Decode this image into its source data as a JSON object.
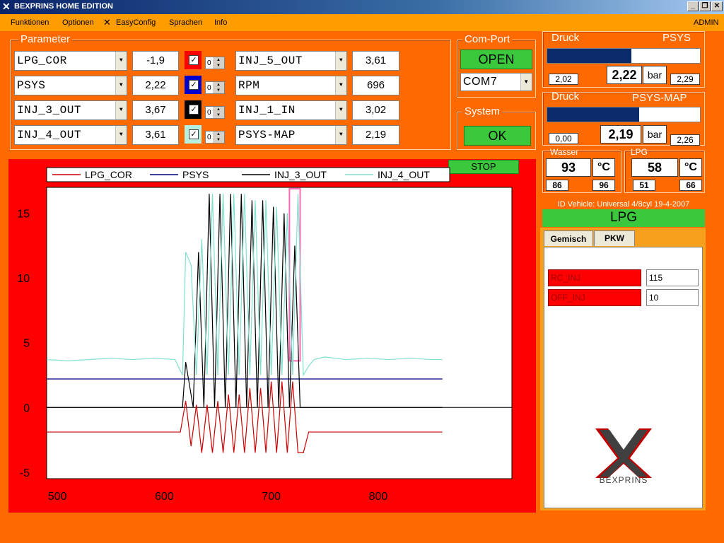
{
  "window": {
    "title": "BEXPRINS  HOME EDITION"
  },
  "menu": {
    "items": [
      "Funktionen",
      "Optionen",
      "EasyConfig",
      "Sprachen",
      "Info"
    ],
    "user": "ADMIN"
  },
  "parameter": {
    "label": "Parameter",
    "left_rows": [
      {
        "name": "LPG_COR",
        "value": "-1,9",
        "color": "#ff0000",
        "checked": true,
        "spin": "0"
      },
      {
        "name": "PSYS",
        "value": "2,22",
        "color": "#0000cc",
        "checked": true,
        "spin": "0"
      },
      {
        "name": "INJ_3_OUT",
        "value": "3,67",
        "color": "#000000",
        "checked": true,
        "spin": "0"
      },
      {
        "name": "INJ_4_OUT",
        "value": "3,61",
        "color": "#b7f0e0",
        "checked": true,
        "spin": "0"
      }
    ],
    "right_rows": [
      {
        "name": "INJ_5_OUT",
        "value": "3,61"
      },
      {
        "name": "RPM",
        "value": "696"
      },
      {
        "name": "INJ_1_IN",
        "value": "3,02"
      },
      {
        "name": "PSYS-MAP",
        "value": "2,19"
      }
    ]
  },
  "comport": {
    "label": "Com-Port",
    "open_label": "OPEN",
    "port": "COM7"
  },
  "system": {
    "label": "System",
    "status": "OK"
  },
  "druck1": {
    "label": "Druck",
    "name": "PSYS",
    "min": "2,02",
    "value": "2,22",
    "unit": "bar",
    "max": "2,29",
    "fill": 0.55
  },
  "druck2": {
    "label": "Druck",
    "name": "PSYS-MAP",
    "min": "0,00",
    "value": "2,19",
    "unit": "bar",
    "max": "2,26",
    "fill": 0.6
  },
  "wasser": {
    "label": "Wasser",
    "value": "93",
    "unit": "°C",
    "min": "86",
    "max": "96"
  },
  "lpg_temp": {
    "label": "LPG",
    "value": "58",
    "unit": "°C",
    "min": "51",
    "max": "66"
  },
  "vehicle": {
    "id_text": "ID Vehicle: Universal 4/8cyl 19-4-2007",
    "fuel": "LPG"
  },
  "tabs": {
    "items": [
      "Gemisch",
      "PKW"
    ]
  },
  "gemisch": [
    {
      "label": "RC_INJ",
      "value": "115"
    },
    {
      "label": "OFF_INJ",
      "value": "10"
    }
  ],
  "logo_text": "BEXPRINS",
  "stop_label": "STOP",
  "chart_data": {
    "type": "line",
    "legend": [
      "LPG_COR",
      "PSYS",
      "INJ_3_OUT",
      "INJ_4_OUT"
    ],
    "xlim": [
      490,
      925
    ],
    "ylim": [
      -5.5,
      17
    ],
    "xticks": [
      "500",
      "600",
      "700",
      "800"
    ],
    "yticks": [
      "15",
      "10",
      "5",
      "0",
      "-5"
    ],
    "colors": {
      "LPG_COR": "#cc0000",
      "PSYS": "#000080",
      "INJ_3_OUT": "#000000",
      "INJ_4_OUT": "#7fe0d0"
    },
    "series": [
      {
        "name": "PSYS",
        "x": [
          490,
          860
        ],
        "y": [
          2.2,
          2.2
        ]
      },
      {
        "name": "INJ_3_OUT",
        "x": [
          490,
          617,
          620,
          627,
          632,
          637,
          642,
          647,
          652,
          657,
          662,
          667,
          672,
          677,
          682,
          687,
          692,
          697,
          702,
          707,
          712,
          717,
          722,
          727,
          730,
          860
        ],
        "y": [
          0,
          0,
          3.5,
          0,
          12,
          0,
          16.5,
          0,
          16.5,
          0,
          16.5,
          0,
          16.5,
          0,
          16,
          0,
          16,
          0,
          15.5,
          0,
          15,
          0,
          12.5,
          0,
          0,
          0
        ]
      },
      {
        "name": "INJ_4_OUT",
        "x": [
          490,
          510,
          530,
          550,
          570,
          590,
          610,
          617,
          620,
          625,
          630,
          635,
          640,
          645,
          650,
          655,
          660,
          665,
          670,
          675,
          680,
          685,
          690,
          695,
          700,
          705,
          710,
          715,
          720,
          725,
          730,
          735,
          740,
          750,
          770,
          790,
          810,
          830,
          850,
          860
        ],
        "y": [
          3.7,
          3.6,
          3.7,
          3.8,
          3.7,
          3.8,
          3.7,
          2.5,
          12,
          11,
          2.5,
          13,
          2.5,
          16.5,
          2.5,
          16.5,
          2.5,
          16.5,
          2.5,
          16.5,
          2.5,
          16,
          2.5,
          16,
          2.5,
          15.5,
          2.5,
          15,
          2.5,
          16.5,
          2.5,
          3.2,
          3.7,
          3.9,
          3.7,
          3.8,
          3.7,
          3.8,
          3.7,
          3.7
        ]
      },
      {
        "name": "LPG_COR",
        "x": [
          490,
          615,
          620,
          625,
          630,
          635,
          640,
          645,
          650,
          655,
          660,
          665,
          670,
          675,
          680,
          685,
          690,
          695,
          700,
          705,
          710,
          715,
          720,
          725,
          730,
          735,
          860
        ],
        "y": [
          -1.9,
          -1.9,
          0.5,
          -3,
          0.2,
          -3.5,
          0.2,
          -3.5,
          0.5,
          -3.5,
          1,
          -3.5,
          1,
          -3.5,
          1.5,
          -3.5,
          1.5,
          -3.5,
          2,
          -3.5,
          2,
          -3.5,
          2,
          -3.5,
          -3.5,
          -1.9,
          -1.9
        ]
      }
    ]
  }
}
